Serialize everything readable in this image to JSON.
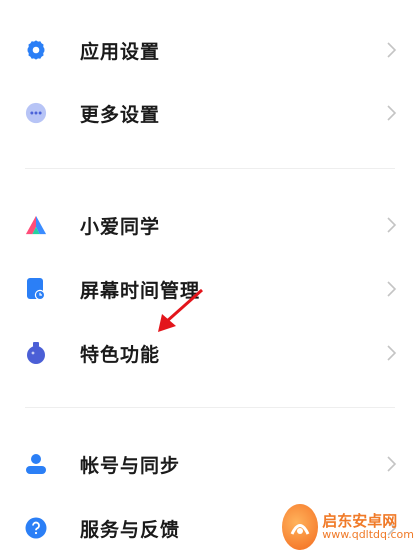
{
  "settings": {
    "items": [
      {
        "label": "应用设置",
        "icon": "gear-icon"
      },
      {
        "label": "更多设置",
        "icon": "more-dots-icon"
      },
      {
        "label": "小爱同学",
        "icon": "xiaoai-icon"
      },
      {
        "label": "屏幕时间管理",
        "icon": "screen-time-icon"
      },
      {
        "label": "特色功能",
        "icon": "flask-icon"
      },
      {
        "label": "帐号与同步",
        "icon": "account-icon"
      },
      {
        "label": "服务与反馈",
        "icon": "help-icon"
      }
    ]
  },
  "colors": {
    "accent_blue": "#2b7ff6",
    "arrow_red": "#e3151b",
    "watermark_orange": "#f07a28"
  },
  "watermark": {
    "title": "启东安卓网",
    "url": "www.qdltdq.com"
  }
}
